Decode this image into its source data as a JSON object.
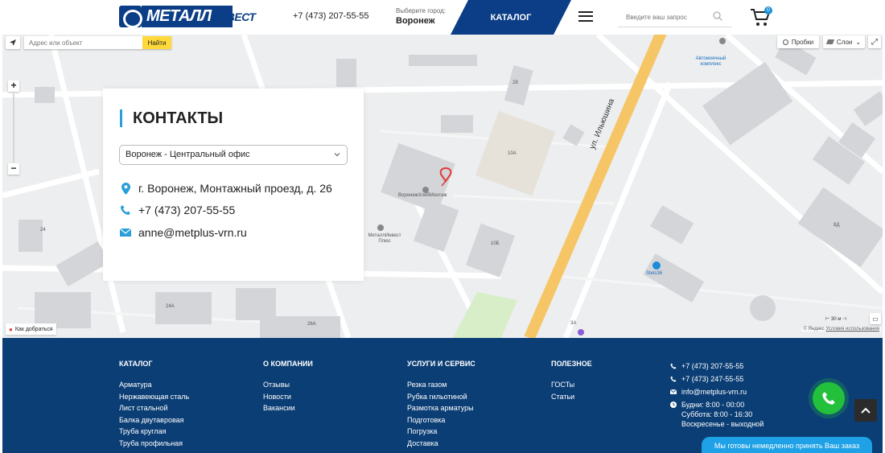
{
  "header": {
    "logo_text_main": "МЕТАЛЛ",
    "logo_text_sub": "ИНВЕСТ",
    "phone": "+7 (473) 207-55-55",
    "city_label": "Выберите город:",
    "city_value": "Воронеж",
    "catalog_label": "КАТАЛОГ",
    "search_placeholder": "Введите ваш запрос",
    "cart_count": "0"
  },
  "map": {
    "address_placeholder": "Адрес или объект",
    "find_button": "Найти",
    "probki_button": "Пробки",
    "layers_button": "Слои",
    "zoom_in": "+",
    "zoom_out": "−",
    "route_button": "Как добраться",
    "scale_label": "30 м",
    "copyright": "© Яндекс",
    "terms_link": "Условия использования",
    "street_label": "ул. Ильюшина",
    "labels": {
      "b28": "28",
      "b10a": "10А",
      "b10b": "10Б",
      "b24": "24",
      "b24a": "24А",
      "b26a": "26А",
      "b8d": "8Д",
      "b3a": "3А",
      "auto": "Автомоечный комплекс",
      "hleb": "ВоронежХлебМонтаж",
      "metplus": "МеталлИнвест Плюс",
      "stels": "Stels36"
    }
  },
  "contacts": {
    "title": "КОНТАКТЫ",
    "office_select": "Воронеж - Центральный офис",
    "address": "г. Воронеж, Монтажный проезд, д. 26",
    "phone": "+7 (473) 207-55-55",
    "email": "anne@metplus-vrn.ru"
  },
  "footer": {
    "catalog": {
      "title": "КАТАЛОГ",
      "items": [
        "Арматура",
        "Нержавеющая сталь",
        "Лист стальной",
        "Балка двутавровая",
        "Труба круглая",
        "Труба профильная"
      ]
    },
    "company": {
      "title": "О КОМПАНИИ",
      "items": [
        "Отзывы",
        "Новости",
        "Вакансии"
      ]
    },
    "services": {
      "title": "УСЛУГИ И СЕРВИС",
      "items": [
        "Резка газом",
        "Рубка гильотиной",
        "Размотка арматуры",
        "Подготовка",
        "Погрузка",
        "Доставка"
      ]
    },
    "useful": {
      "title": "ПОЛЕЗНОЕ",
      "items": [
        "ГОСТы",
        "Статьи"
      ]
    },
    "contacts": {
      "phone1": "+7 (473) 207-55-55",
      "phone2": "+7 (473) 247-55-55",
      "email": "info@metplus-vrn.ru",
      "hours1": "Будни: 8:00 - 00:00",
      "hours2": "Суббота: 8:00 - 16:30",
      "hours3": "Воскресенье - выходной"
    }
  },
  "chat_tab": "Мы готовы немедленно принять Ваш заказ",
  "colors": {
    "brand_blue": "#0b3e86",
    "footer_blue": "#0b3e75",
    "accent": "#2a9fd8",
    "road_yellow": "#f6c566",
    "call_green": "#23c13b",
    "chat_blue": "#1ea1e6"
  }
}
